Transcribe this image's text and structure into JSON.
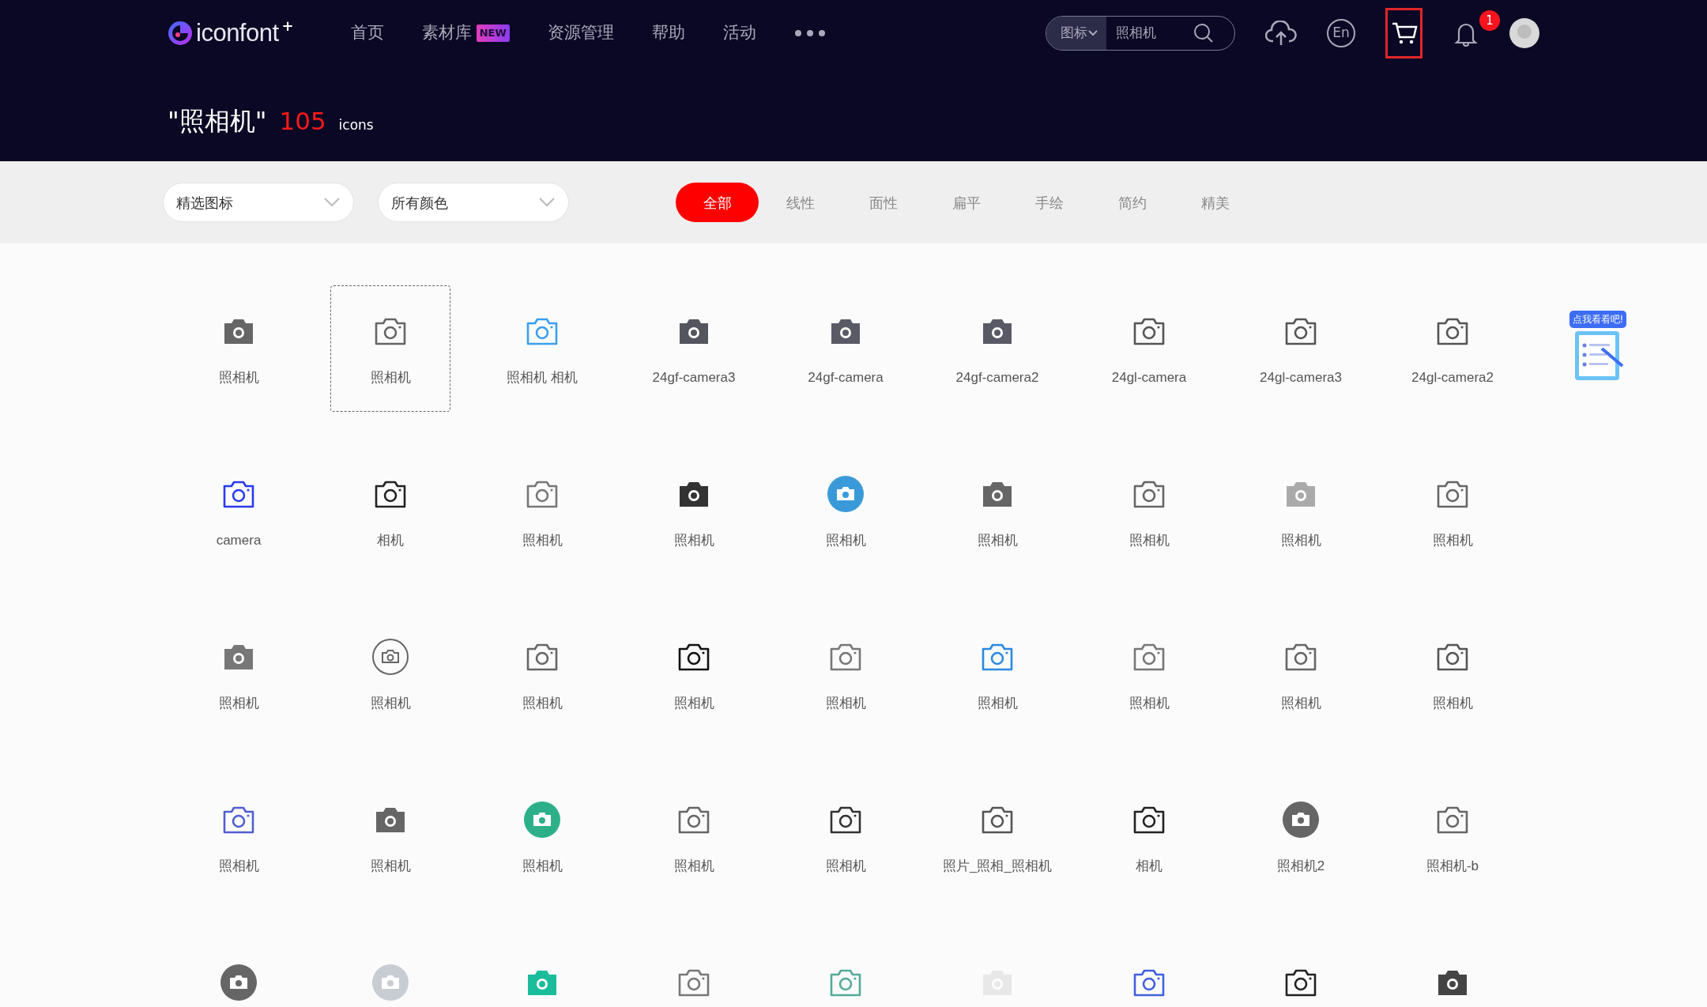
{
  "header": {
    "logo": "iconfont",
    "logo_mark": "+",
    "nav": [
      {
        "label": "首页"
      },
      {
        "label": "素材库",
        "badge": "NEW"
      },
      {
        "label": "资源管理"
      },
      {
        "label": "帮助"
      },
      {
        "label": "活动"
      }
    ],
    "search": {
      "scope": "图标",
      "value": "照相机"
    },
    "language": "En",
    "cart": {
      "highlighted": true
    },
    "notifications": {
      "count": "1"
    }
  },
  "results": {
    "query": "\"照相机\"",
    "count": "105",
    "unit": "icons"
  },
  "filters": {
    "dropdowns": [
      {
        "value": "精选图标"
      },
      {
        "value": "所有颜色"
      }
    ],
    "styles": [
      {
        "label": "全部",
        "selected": true
      },
      {
        "label": "线性",
        "selected": false
      },
      {
        "label": "面性",
        "selected": false
      },
      {
        "label": "扁平",
        "selected": false
      },
      {
        "label": "手绘",
        "selected": false
      },
      {
        "label": "简约",
        "selected": false
      },
      {
        "label": "精美",
        "selected": false
      }
    ]
  },
  "promo": {
    "label": "点我看看吧!"
  },
  "icons": [
    {
      "label": "照相机",
      "kind": "filled",
      "color": "#666666",
      "selected": false
    },
    {
      "label": "照相机",
      "kind": "outline",
      "color": "#666666",
      "selected": true
    },
    {
      "label": "照相机 相机",
      "kind": "outline",
      "color": "#3a9ef0",
      "selected": false
    },
    {
      "label": "24gf-camera3",
      "kind": "filled",
      "color": "#55555f",
      "selected": false
    },
    {
      "label": "24gf-camera",
      "kind": "filled",
      "color": "#5a5a66",
      "selected": false
    },
    {
      "label": "24gf-camera2",
      "kind": "filled",
      "color": "#5a5a66",
      "selected": false
    },
    {
      "label": "24gl-camera",
      "kind": "outline",
      "color": "#555555",
      "selected": false
    },
    {
      "label": "24gl-camera3",
      "kind": "outline",
      "color": "#555555",
      "selected": false
    },
    {
      "label": "24gl-camera2",
      "kind": "outline",
      "color": "#555555",
      "selected": false
    },
    {
      "label": "camera",
      "kind": "outline",
      "color": "#2b3bf0",
      "selected": false
    },
    {
      "label": "相机",
      "kind": "outline",
      "color": "#222222",
      "selected": false
    },
    {
      "label": "照相机",
      "kind": "outline",
      "color": "#777777",
      "selected": false
    },
    {
      "label": "照相机",
      "kind": "filled",
      "color": "#333333",
      "selected": false
    },
    {
      "label": "照相机",
      "kind": "disc",
      "color": "#3a9ad9",
      "selected": false
    },
    {
      "label": "照相机",
      "kind": "filled",
      "color": "#666666",
      "selected": false
    },
    {
      "label": "照相机",
      "kind": "outline",
      "color": "#666666",
      "selected": false
    },
    {
      "label": "照相机",
      "kind": "filled",
      "color": "#aaaaaa",
      "selected": false
    },
    {
      "label": "照相机",
      "kind": "outline",
      "color": "#666666",
      "selected": false
    },
    {
      "label": "照相机",
      "kind": "filled",
      "color": "#777777",
      "selected": false
    },
    {
      "label": "照相机",
      "kind": "ring",
      "color": "#666666",
      "selected": false
    },
    {
      "label": "照相机",
      "kind": "outline",
      "color": "#666666",
      "selected": false
    },
    {
      "label": "照相机",
      "kind": "outline",
      "color": "#111111",
      "selected": false
    },
    {
      "label": "照相机",
      "kind": "outline",
      "color": "#777777",
      "selected": false
    },
    {
      "label": "照相机",
      "kind": "outline",
      "color": "#2a8ae0",
      "selected": false
    },
    {
      "label": "照相机",
      "kind": "outline",
      "color": "#777777",
      "selected": false
    },
    {
      "label": "照相机",
      "kind": "outline",
      "color": "#666666",
      "selected": false
    },
    {
      "label": "照相机",
      "kind": "outline",
      "color": "#555555",
      "selected": false
    },
    {
      "label": "照相机",
      "kind": "outline",
      "color": "#5060d0",
      "selected": false
    },
    {
      "label": "照相机",
      "kind": "filled",
      "color": "#666666",
      "selected": false
    },
    {
      "label": "照相机",
      "kind": "disc",
      "color": "#2db08a",
      "selected": false
    },
    {
      "label": "照相机",
      "kind": "outline",
      "color": "#666666",
      "selected": false
    },
    {
      "label": "照相机",
      "kind": "outline",
      "color": "#333333",
      "selected": false
    },
    {
      "label": "照片_照相_照相机",
      "kind": "outline",
      "color": "#555555",
      "selected": false
    },
    {
      "label": "相机",
      "kind": "outline",
      "color": "#222222",
      "selected": false
    },
    {
      "label": "照相机2",
      "kind": "disc",
      "color": "#666666",
      "selected": false
    },
    {
      "label": "照相机-b",
      "kind": "outline",
      "color": "#666666",
      "selected": false
    },
    {
      "kind": "disc",
      "color": "#666666",
      "selected": false
    },
    {
      "kind": "disc",
      "color": "#c8cdd4",
      "selected": false
    },
    {
      "kind": "filled",
      "color": "#1abc9c",
      "selected": false
    },
    {
      "kind": "outline",
      "color": "#777777",
      "selected": false
    },
    {
      "kind": "outline",
      "color": "#55aa99",
      "selected": false
    },
    {
      "kind": "filled",
      "color": "#e8e8e8",
      "selected": false
    },
    {
      "kind": "outline",
      "color": "#4060e0",
      "selected": false
    },
    {
      "kind": "outline",
      "color": "#222222",
      "selected": false
    },
    {
      "kind": "filled",
      "color": "#444444",
      "selected": false
    }
  ]
}
